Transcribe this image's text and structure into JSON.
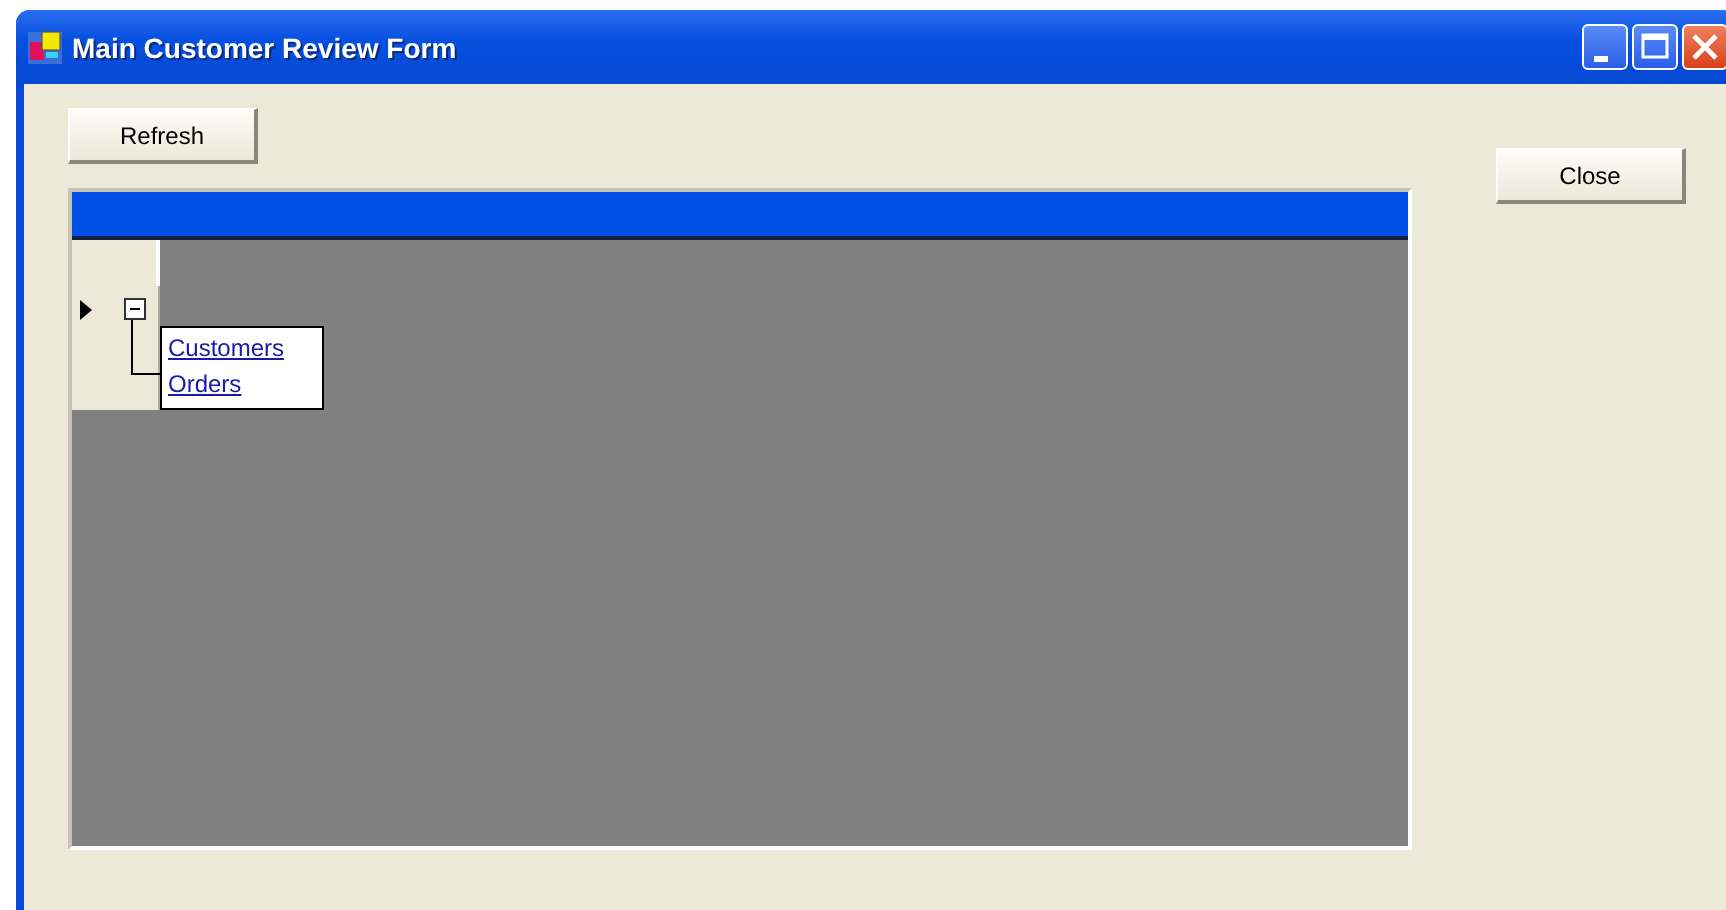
{
  "window": {
    "title": "Main Customer Review Form"
  },
  "buttons": {
    "refresh": "Refresh",
    "close": "Close"
  },
  "grid": {
    "row_expanded": true,
    "links": [
      "Customers",
      "Orders"
    ]
  }
}
